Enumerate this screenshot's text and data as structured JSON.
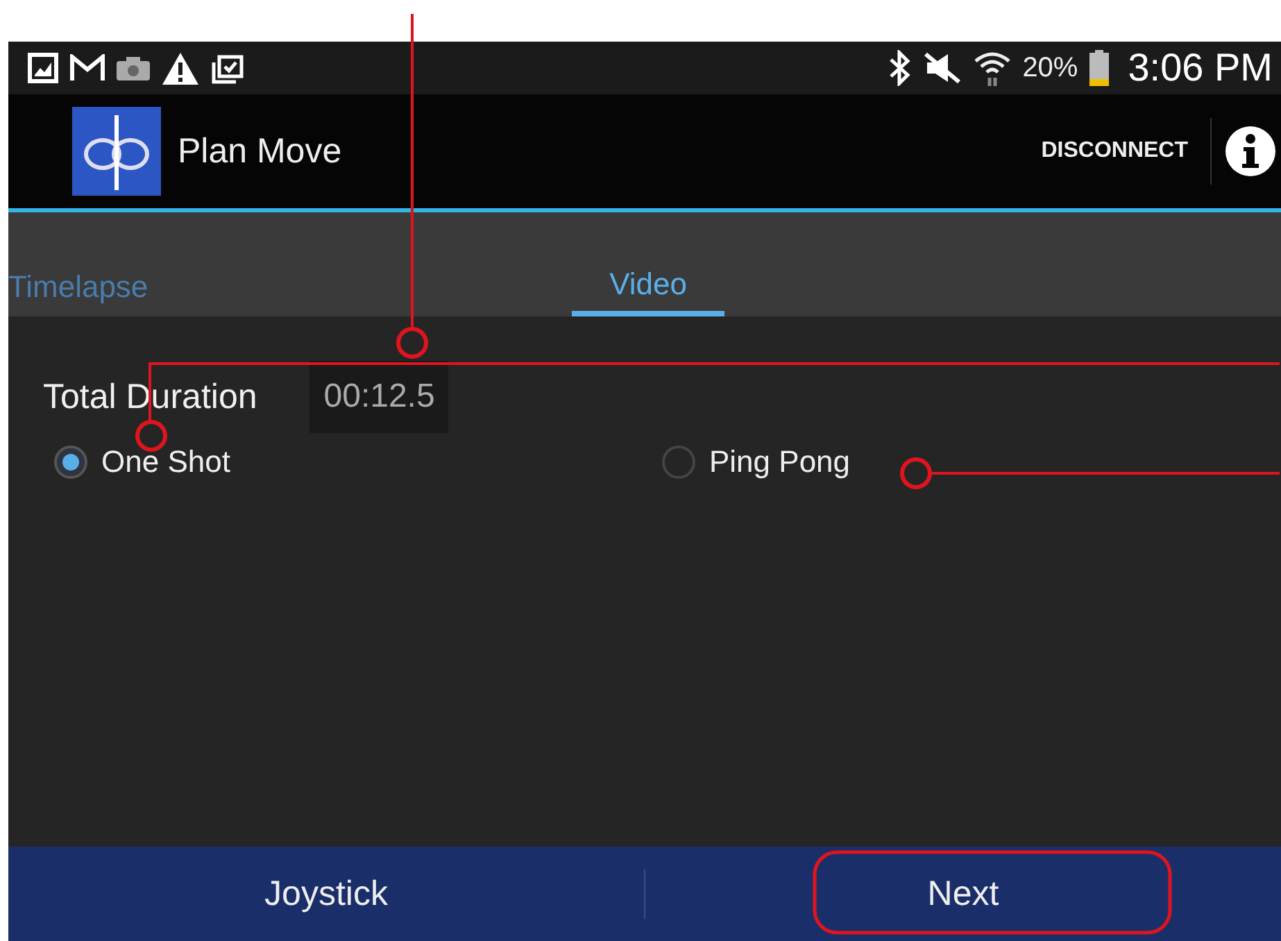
{
  "status_bar": {
    "battery": "20%",
    "time": "3:06 PM"
  },
  "action_bar": {
    "title": "Plan Move",
    "action": "DISCONNECT"
  },
  "tabs": [
    {
      "label": "Timelapse",
      "selected": false
    },
    {
      "label": "Video",
      "selected": true
    }
  ],
  "duration": {
    "label": "Total Duration",
    "value": "00:12.5"
  },
  "modes": [
    {
      "label": "One Shot",
      "selected": true
    },
    {
      "label": "Ping Pong",
      "selected": false
    }
  ],
  "bottom_bar": {
    "buttons": [
      "Joystick",
      "Next"
    ]
  }
}
